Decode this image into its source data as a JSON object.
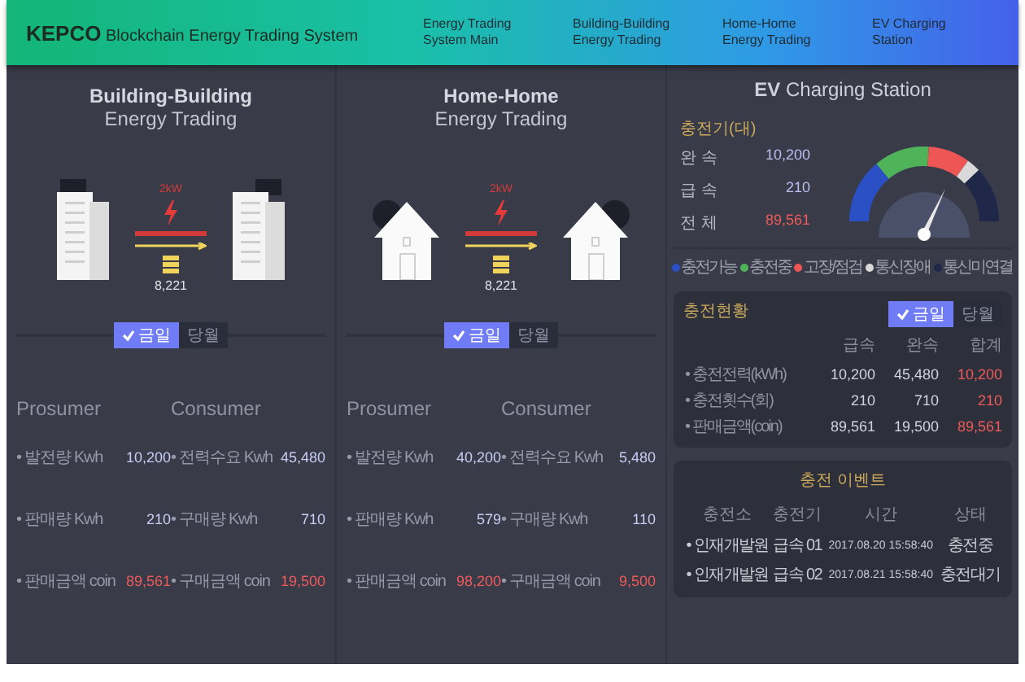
{
  "header": {
    "title": "**KEPCO** Blockchain Energy Trading System",
    "nav": [
      {
        "label": "Energy Trading\nSystem Main"
      },
      {
        "label": "Building-Building\nEnergy Trading"
      },
      {
        "label": "Home-Home\nEnergy Trading"
      },
      {
        "label": "EV Charging\nStation"
      }
    ]
  },
  "trading_panels": [
    {
      "kind": "building",
      "title": "Building-Building",
      "subtitle": "Energy Trading",
      "transfer_label": "2kW",
      "amount": "8,221",
      "period_tabs": [
        {
          "label": "금일",
          "selected": true
        },
        {
          "label": "당월",
          "selected": false
        }
      ],
      "groups": [
        {
          "title": "Prosumer",
          "rows": [
            {
              "label": "• 발전량 Kwh",
              "value": "10,200",
              "emphasis": false
            },
            {
              "label": "• 판매량 Kwh",
              "value": "210",
              "emphasis": false
            },
            {
              "label": "• 판매금액 coin",
              "value": "89,561",
              "emphasis": true
            }
          ]
        },
        {
          "title": "Consumer",
          "rows": [
            {
              "label": "• 전력수요 Kwh",
              "value": "45,480",
              "emphasis": false
            },
            {
              "label": "• 구매량 Kwh",
              "value": "710",
              "emphasis": false
            },
            {
              "label": "• 구매금액 coin",
              "value": "19,500",
              "emphasis": true
            }
          ]
        }
      ]
    },
    {
      "kind": "house",
      "title": "Home-Home",
      "subtitle": "Energy Trading",
      "transfer_label": "2kW",
      "amount": "8,221",
      "period_tabs": [
        {
          "label": "금일",
          "selected": true
        },
        {
          "label": "당월",
          "selected": false
        }
      ],
      "groups": [
        {
          "title": "Prosumer",
          "rows": [
            {
              "label": "• 발전량 Kwh",
              "value": "40,200",
              "emphasis": false
            },
            {
              "label": "• 판매량 Kwh",
              "value": "579",
              "emphasis": false
            },
            {
              "label": "• 판매금액 coin",
              "value": "98,200",
              "emphasis": true
            }
          ]
        },
        {
          "title": "Consumer",
          "rows": [
            {
              "label": "• 전력수요 Kwh",
              "value": "5,480",
              "emphasis": false
            },
            {
              "label": "• 구매량 Kwh",
              "value": "110",
              "emphasis": false
            },
            {
              "label": "• 구매금액 coin",
              "value": "9,500",
              "emphasis": true
            }
          ]
        }
      ]
    }
  ],
  "ev": {
    "title": "**EV** Charging Station",
    "chargers": {
      "title": "충전기(대)",
      "rows": [
        {
          "label": "완 속",
          "value": "10,200",
          "emphasis": false
        },
        {
          "label": "급 속",
          "value": "210",
          "emphasis": false
        },
        {
          "label": "전 체",
          "value": "89,561",
          "emphasis": true
        }
      ]
    },
    "legend": [
      {
        "label": "충전가능",
        "color": "#2b4fc4"
      },
      {
        "label": "충전중",
        "color": "#4fb35a"
      },
      {
        "label": "고장/점검",
        "color": "#ee5555"
      },
      {
        "label": "통신장애",
        "color": "#d9d9d9"
      },
      {
        "label": "통신미연결",
        "color": "#1f2848"
      }
    ],
    "status": {
      "title": "충전현황",
      "tabs": [
        {
          "label": "금일",
          "selected": true
        },
        {
          "label": "당월",
          "selected": false
        }
      ],
      "columns": [
        {
          "label": "급속",
          "emphasis": false
        },
        {
          "label": "완속",
          "emphasis": false
        },
        {
          "label": "합계",
          "emphasis": true
        }
      ],
      "rows": [
        {
          "label": "• 충전전력(kWh)",
          "values": [
            "10,200",
            "45,480",
            "10,200"
          ]
        },
        {
          "label": "• 충전횟수(회)",
          "values": [
            "210",
            "710",
            "210"
          ]
        },
        {
          "label": "• 판매금액(coin)",
          "values": [
            "89,561",
            "19,500",
            "89,561"
          ]
        }
      ]
    },
    "events": {
      "title": "충전 이벤트",
      "columns": [
        "충전소",
        "충전기",
        "시간",
        "상태"
      ],
      "rows": [
        {
          "cells": [
            "• 인재개발원",
            "급속 01",
            "2017.08.20 15:58:40",
            "충전중"
          ]
        },
        {
          "cells": [
            "• 인재개발원",
            "급속 02",
            "2017.08.21 15:58:40",
            "충전대기"
          ]
        }
      ]
    }
  }
}
